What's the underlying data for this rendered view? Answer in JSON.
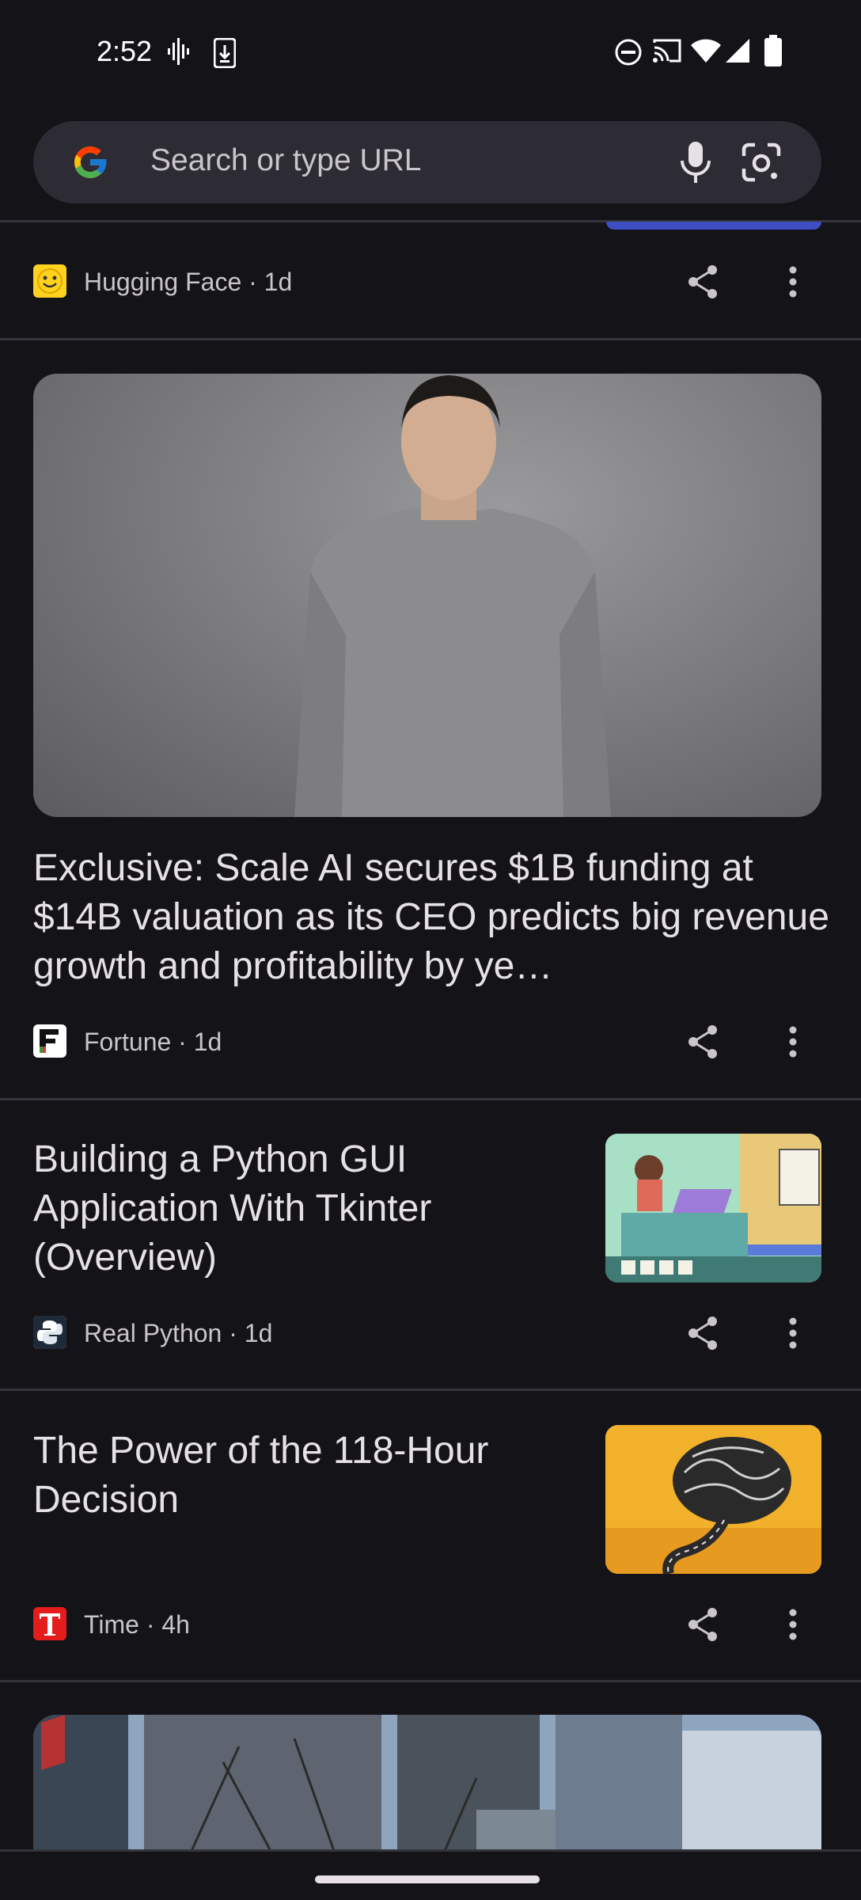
{
  "status_bar": {
    "time": "2:52"
  },
  "search": {
    "placeholder": "Search or type URL"
  },
  "feed": {
    "cards": [
      {
        "source": "Hugging Face · 1d"
      },
      {
        "headline": "Exclusive: Scale AI secures $1B funding at $14B valuation as its CEO predicts big revenue growth and profitability by ye…",
        "source": "Fortune · 1d"
      },
      {
        "headline": "Building a Python GUI Application With Tkinter (Overview)",
        "source": "Real Python · 1d"
      },
      {
        "headline": "The Power of the 118-Hour Decision",
        "source": "Time · 4h"
      }
    ]
  },
  "icons": {
    "share": "share-icon",
    "more": "more-vert-icon",
    "mic": "mic-icon",
    "lens": "google-lens-icon"
  },
  "colors": {
    "background": "#141318",
    "search_bg": "#2d2b33",
    "text_primary": "#e6e1e6",
    "text_secondary": "#c9c5ca",
    "divider": "#36343b"
  }
}
